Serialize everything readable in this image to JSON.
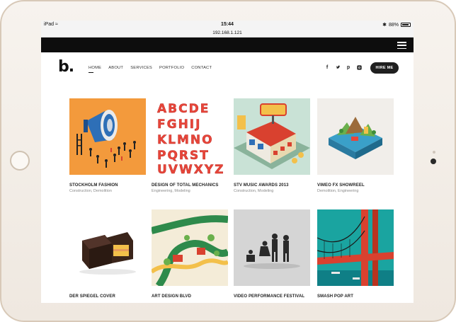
{
  "status_bar": {
    "device": "iPad",
    "time": "15:44",
    "battery": "88%"
  },
  "url": "192.168.1.121",
  "site": {
    "logo": "b.",
    "nav": [
      {
        "label": "HOME",
        "active": true
      },
      {
        "label": "ABOUT",
        "active": false
      },
      {
        "label": "SERVICES",
        "active": false
      },
      {
        "label": "PORTFOLIO",
        "active": false
      },
      {
        "label": "CONTACT",
        "active": false
      }
    ],
    "social": [
      "f",
      "t",
      "p",
      "ig"
    ],
    "hire_label": "HIRE ME"
  },
  "portfolio": [
    {
      "title": "STOCKHOLM FASHION",
      "tags": "Construction, Demolition"
    },
    {
      "title": "DESIGN OF TOTAL MECHANICS",
      "tags": "Engineering, Modeling"
    },
    {
      "title": "STV MUSIC AWARDS 2013",
      "tags": "Construction, Modeling"
    },
    {
      "title": "VIMEO FX SHOWREEL",
      "tags": "Demolition, Engineering"
    },
    {
      "title": "DER SPIEGEL COVER",
      "tags": ""
    },
    {
      "title": "ART DESIGN BLVD",
      "tags": ""
    },
    {
      "title": "VIDEO PERFORMANCE FESTIVAL",
      "tags": ""
    },
    {
      "title": "SMASH POP ART",
      "tags": ""
    }
  ],
  "alphabet": [
    "ABCDE",
    "FGHIJ",
    "KLMNO",
    "PQRST",
    "UVWXYZ"
  ],
  "colors": {
    "orange": "#f39a3c",
    "lettering": "#e8463a",
    "bridge_red": "#d9412f",
    "teal": "#1aa4a0"
  }
}
